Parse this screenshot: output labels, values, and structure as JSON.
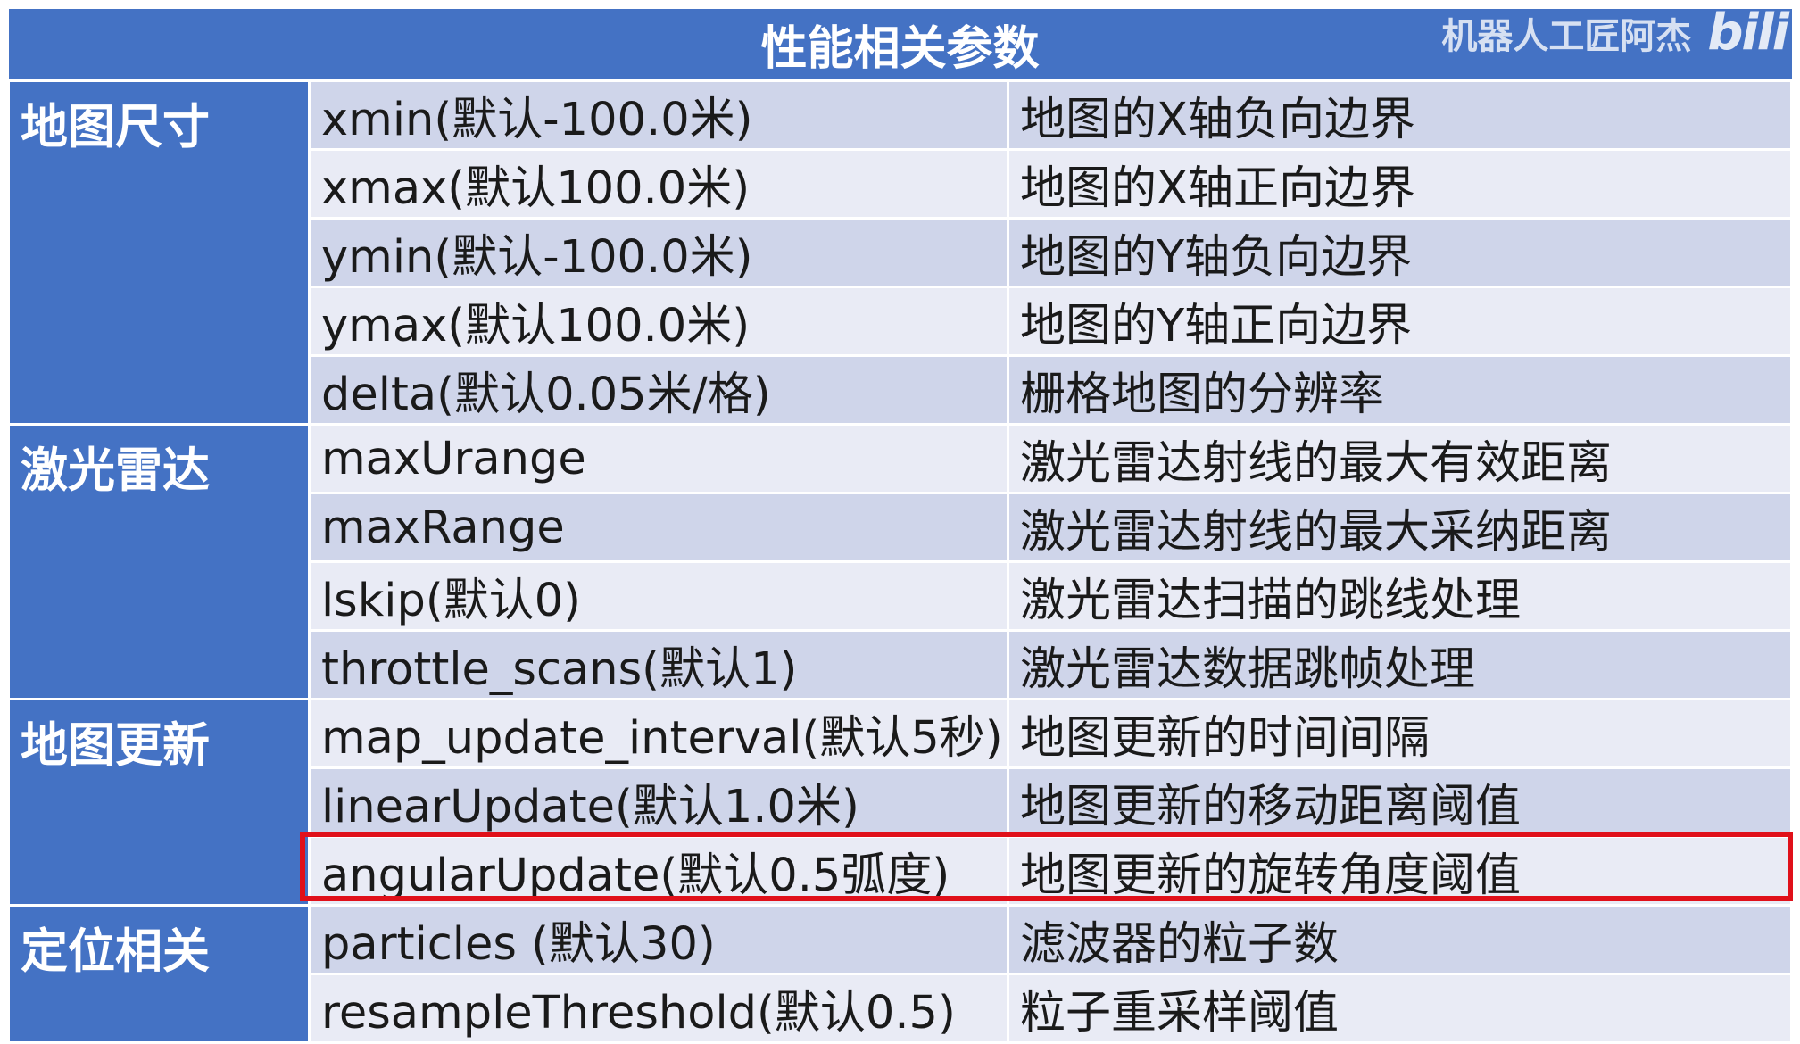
{
  "table": {
    "title": "性能相关参数",
    "groups": [
      {
        "name": "地图尺寸",
        "rows": [
          {
            "param": "xmin(默认-100.0米)",
            "desc": "地图的X轴负向边界"
          },
          {
            "param": "xmax(默认100.0米)",
            "desc": "地图的X轴正向边界"
          },
          {
            "param": "ymin(默认-100.0米)",
            "desc": "地图的Y轴负向边界"
          },
          {
            "param": "ymax(默认100.0米)",
            "desc": "地图的Y轴正向边界"
          },
          {
            "param": "delta(默认0.05米/格)",
            "desc": "栅格地图的分辨率"
          }
        ]
      },
      {
        "name": "激光雷达",
        "rows": [
          {
            "param": "maxUrange",
            "desc": "激光雷达射线的最大有效距离"
          },
          {
            "param": "maxRange",
            "desc": "激光雷达射线的最大采纳距离"
          },
          {
            "param": "lskip(默认0)",
            "desc": "激光雷达扫描的跳线处理"
          },
          {
            "param": "throttle_scans(默认1)",
            "desc": "激光雷达数据跳帧处理"
          }
        ]
      },
      {
        "name": "地图更新",
        "rows": [
          {
            "param": "map_update_interval(默认5秒)",
            "desc": "地图更新的时间间隔"
          },
          {
            "param": "linearUpdate(默认1.0米)",
            "desc": "地图更新的移动距离阈值"
          },
          {
            "param": "angularUpdate(默认0.5弧度)",
            "desc": "地图更新的旋转角度阈值"
          }
        ]
      },
      {
        "name": "定位相关",
        "rows": [
          {
            "param": "particles (默认30)",
            "desc": "滤波器的粒子数"
          },
          {
            "param": "resampleThreshold(默认0.5)",
            "desc": "粒子重采样阈值"
          }
        ]
      }
    ]
  },
  "watermark": {
    "text": "机器人工匠阿杰",
    "logo": "bili"
  },
  "highlight": {
    "color": "#e0101a",
    "group": 3,
    "row": 0
  },
  "colors": {
    "header_blue": "#4472c4",
    "row_dark": "#cfd5ea",
    "row_light": "#e9ebf5"
  }
}
